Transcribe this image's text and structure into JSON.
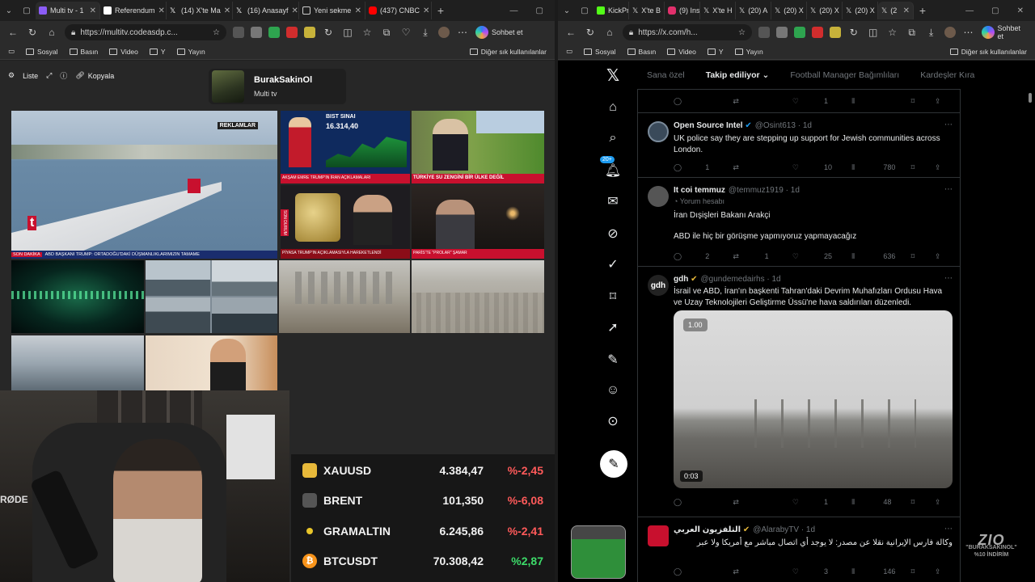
{
  "left_window": {
    "tabs": [
      {
        "label": "Multi tv - 1",
        "color": "#8b5cf6",
        "active": true
      },
      {
        "label": "Referendum",
        "color": "#ffffff"
      },
      {
        "label": "(14) X'te Ma",
        "color": "#000000"
      },
      {
        "label": "(16) Anasayf",
        "color": "#000000"
      },
      {
        "label": "Yeni sekme",
        "color": "#3b82f6"
      },
      {
        "label": "(437) CNBC",
        "color": "#ff0000"
      }
    ],
    "url": "https://multitv.codeasdp.c...",
    "copilot_label": "Sohbet et",
    "bookmarks": [
      "Sosyal",
      "Basın",
      "Video",
      "Y",
      "Yayın"
    ],
    "bookmarks_other": "Diğer sık kullanılanlar"
  },
  "right_window": {
    "tabs": [
      {
        "label": "KickPr",
        "color": "#53fc18"
      },
      {
        "label": "X'te B",
        "color": "#000000"
      },
      {
        "label": "(9) Ins",
        "color": "#e1306c"
      },
      {
        "label": "X'te H",
        "color": "#000000"
      },
      {
        "label": "(20) A",
        "color": "#000000"
      },
      {
        "label": "(20) X",
        "color": "#000000"
      },
      {
        "label": "(20) X",
        "color": "#000000"
      },
      {
        "label": "(20) X",
        "color": "#000000"
      },
      {
        "label": "(2",
        "color": "#000000",
        "active": true
      }
    ],
    "url": "https://x.com/h...",
    "copilot_label": "Sohbet et",
    "bookmarks": [
      "Sosyal",
      "Basın",
      "Video",
      "Y",
      "Yayın"
    ],
    "bookmarks_other": "Diğer sık kullanılanlar"
  },
  "multitv": {
    "tools": {
      "list": "Liste",
      "copy": "Kopyala"
    },
    "profile": {
      "name": "BurakSakinOl",
      "subtitle": "Multi tv"
    },
    "cells": [
      {
        "label": "REKLAMLAR",
        "ticker": "ABD BAŞKANI TRUMP: ORTADOĞU'DAKİ DÜŞMANLIKLARIMIZIN TAMAME",
        "tag": "SON DAKİKA"
      },
      {
        "label": "BIST SINAI",
        "value": "16.314,40",
        "ticker": "AKŞAM EMRE TRUMP'IN İRAN AÇIKLAMALARI"
      },
      {
        "ticker": "TÜRKİYE SU ZENGİNİ BİR ÜLKE DEĞİL"
      },
      {
        "tag": "SON DURUM",
        "ticker": "PİYASA TRUMP'IN AÇIKLAMASIYLA HAREKETLENDİ"
      },
      {
        "ticker": "PARİS'TE \"PROLAR\" ŞAMAR"
      }
    ]
  },
  "ticker": [
    {
      "symbol": "XAUUSD",
      "value": "4.384,47",
      "change": "%-2,45",
      "color": "#ff5a5a",
      "icon_color": "#e8b93a"
    },
    {
      "symbol": "BRENT",
      "value": "101,350",
      "change": "%-6,08",
      "color": "#ff5a5a",
      "icon_color": "#555555"
    },
    {
      "symbol": "GRAMALTIN",
      "value": "6.245,86",
      "change": "%-2,41",
      "color": "#ff5a5a",
      "icon_color": "#e8c52a"
    },
    {
      "symbol": "BTCUSDT",
      "value": "70.308,42",
      "change": "%2,87",
      "color": "#3ddc6a",
      "icon_color": "#f7931a"
    }
  ],
  "x": {
    "tabs": [
      "Sana özel",
      "Takip ediliyor",
      "Football Manager Bağımlıları",
      "Kardeşler Kıra"
    ],
    "nav_badge": "20+",
    "top_actions": {
      "reply": "",
      "retweet": "",
      "like": "1",
      "views": ""
    },
    "tweets": [
      {
        "name": "Open Source Intel",
        "handle": "@Osint613 · 1d",
        "text": "UK police say they are stepping up support for Jewish communities across London.",
        "reply": "1",
        "retweet": "",
        "like": "10",
        "views": "780",
        "avatar_color": "#3a4a5a"
      },
      {
        "name": "It coi temmuz",
        "handle": "@temmuz1919 · 1d",
        "sub": "Yorum hesabı",
        "text": "İran Dışişleri Bakanı Arakçi",
        "text2": "ABD ile hiç bir görüşme yapmıyoruz yapmayacağız",
        "reply": "2",
        "retweet": "1",
        "like": "25",
        "views": "636",
        "avatar_color": "#555555"
      },
      {
        "name": "gdh",
        "handle": "@gundemedairhs · 1d",
        "text": "İsrail ve ABD, İran'ın başkenti Tahran'daki Devrim Muhafızları Ordusu Hava ve Uzay Teknolojileri Geliştirme Üssü'ne hava saldırıları düzenledi.",
        "video_rate": "1.00",
        "video_time": "0:03",
        "reply": "",
        "retweet": "",
        "like": "1",
        "views": "48",
        "avatar_color": "#222222"
      },
      {
        "name": "التلفزيون العربي",
        "handle": "@AlarabyTV · 1d",
        "text": "وكالة فارس الإيرانية نقلا عن مصدر: لا يوجد أي اتصال مباشر مع أمريكا ولا عبر",
        "reply": "",
        "retweet": "",
        "like": "3",
        "views": "146",
        "avatar_color": "#c8102e"
      }
    ]
  },
  "watermark": {
    "logo": "ZIO",
    "line1": "\"BURAKSAKINOL\"",
    "line2": "%10 İNDİRİM"
  }
}
